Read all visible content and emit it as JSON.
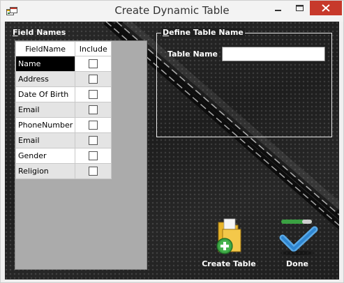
{
  "window": {
    "title": "Create Dynamic Table"
  },
  "field_names": {
    "label_accel": "F",
    "label_rest": "ield Names",
    "columns": {
      "name": "FieldName",
      "include": "Include"
    },
    "rows": [
      {
        "name": "Name",
        "include": false,
        "selected": true
      },
      {
        "name": "Address",
        "include": false
      },
      {
        "name": "Date Of Birth",
        "include": false
      },
      {
        "name": "Email",
        "include": false
      },
      {
        "name": "PhoneNumber",
        "include": false
      },
      {
        "name": "Email",
        "include": false
      },
      {
        "name": "Gender",
        "include": false
      },
      {
        "name": "Religion",
        "include": false
      }
    ]
  },
  "define_table": {
    "group_accel": "D",
    "group_rest": "efine Table Name",
    "table_name_label": "Table Name",
    "table_name_value": ""
  },
  "actions": {
    "create_label": "Create Table",
    "done_label": "Done"
  },
  "colors": {
    "close_button": "#c7392b",
    "background": "#1e1e1e",
    "selected_row": "#000000",
    "grid_panel": "#ababab"
  }
}
